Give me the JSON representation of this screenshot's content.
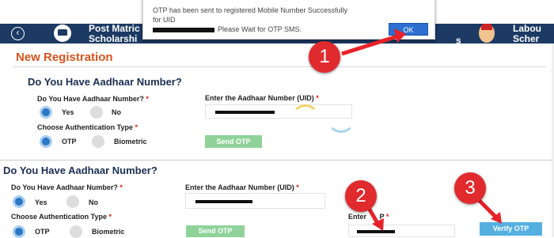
{
  "header": {
    "back_icon": "‹",
    "title": "Post Matric\nScholarshi",
    "right_fragment": "s",
    "title2": "Labou\nScher"
  },
  "dialog": {
    "message_line1": "OTP has been sent to registered Mobile Number Successfully for UID",
    "message_line2": "Please Wait for OTP SMS.",
    "ok_label": "OK"
  },
  "callouts": [
    "1",
    "2",
    "3"
  ],
  "registration": {
    "title": "New Registration",
    "heading": "Do You Have Aadhaar Number?",
    "q_label": "Do You Have Aadhaar Number?",
    "yes": "Yes",
    "no": "No",
    "auth_label": "Choose Authentication Type",
    "otp": "OTP",
    "biometric": "Biometric",
    "uid_label": "Enter the Aadhaar Number (UID)",
    "send_otp": "Send OTP"
  },
  "second": {
    "heading": "Do You Have Aadhaar Number?",
    "q_label": "Do You Have Aadhaar Number?",
    "yes": "Yes",
    "no": "No",
    "auth_label": "Choose Authentication Type",
    "otp": "OTP",
    "biometric": "Biometric",
    "uid_label": "Enter the Aadhaar Number (UID)",
    "send_otp": "Send OTP",
    "enter_otp_label": "Enter",
    "enter_otp_label_tail": "P",
    "verify_otp": "Verify OTP"
  },
  "required_mark": "*"
}
